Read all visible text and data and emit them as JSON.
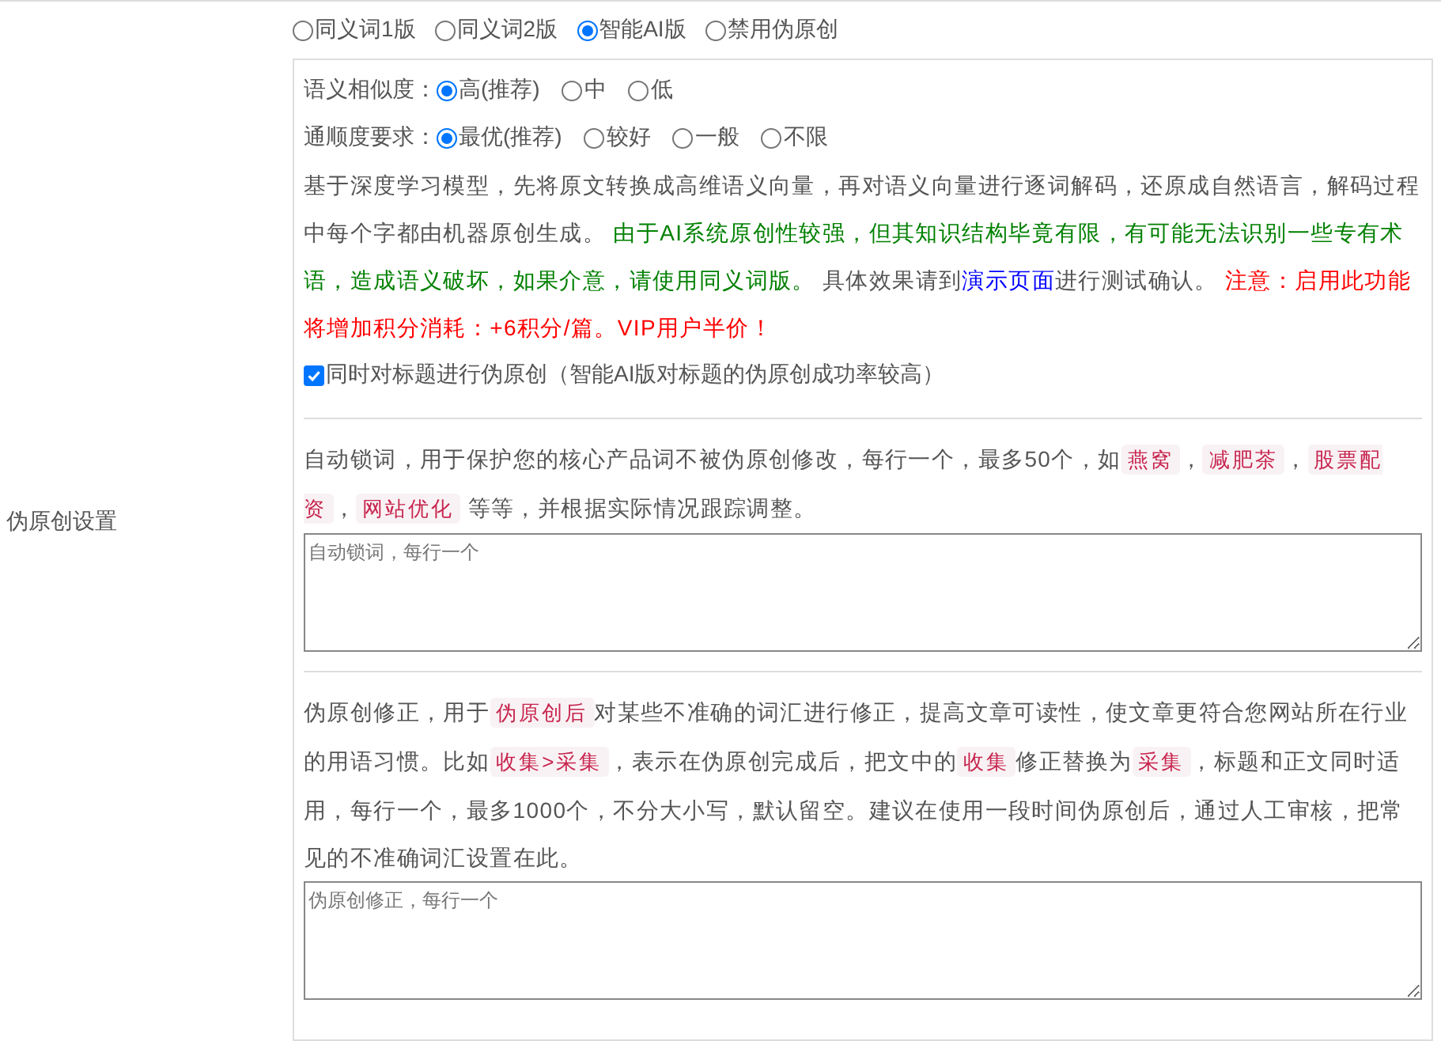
{
  "side_label": "伪原创设置",
  "modes": [
    {
      "label": "同义词1版",
      "selected": false
    },
    {
      "label": "同义词2版",
      "selected": false
    },
    {
      "label": "智能AI版",
      "selected": true
    },
    {
      "label": "禁用伪原创",
      "selected": false
    }
  ],
  "settings": [
    {
      "label": "语义相似度：",
      "options": [
        {
          "label": "高(推荐)",
          "selected": true
        },
        {
          "label": "中",
          "selected": false
        },
        {
          "label": "低",
          "selected": false
        }
      ]
    },
    {
      "label": "通顺度要求：",
      "options": [
        {
          "label": "最优(推荐)",
          "selected": true
        },
        {
          "label": "较好",
          "selected": false
        },
        {
          "label": "一般",
          "selected": false
        },
        {
          "label": "不限",
          "selected": false
        }
      ]
    }
  ],
  "description": [
    {
      "kind": "plain",
      "text": "基于深度学习模型，先将原文转换成高维语义向量，再对语义向量进行逐词解码，还原成自然语言，解码过程中每个字都由机器原创生成。 "
    },
    {
      "kind": "green",
      "text": "由于AI系统原创性较强，但其知识结构毕竟有限，有可能无法识别一些专有术语，造成语义破坏，如果介意，请使用同义词版。"
    },
    {
      "kind": "plain",
      "text": " 具体效果请到"
    },
    {
      "kind": "link",
      "text": "演示页面"
    },
    {
      "kind": "plain",
      "text": "进行测试确认。 "
    },
    {
      "kind": "red",
      "text": "注意：启用此功能将增加积分消耗：+6积分/篇。VIP用户半价！"
    }
  ],
  "title_option": {
    "label": "同时对标题进行伪原创（智能AI版对标题的伪原创成功率较高）",
    "checked": true
  },
  "sections": [
    {
      "description": [
        {
          "kind": "plain",
          "text": "自动锁词，用于保护您的核心产品词不被伪原创修改，每行一个，最多50个，如"
        },
        {
          "kind": "code",
          "text": "燕窝"
        },
        {
          "kind": "plain",
          "text": "，"
        },
        {
          "kind": "code",
          "text": "减肥茶"
        },
        {
          "kind": "plain",
          "text": "，"
        },
        {
          "kind": "code",
          "text": "股票配资"
        },
        {
          "kind": "plain",
          "text": "，"
        },
        {
          "kind": "code",
          "text": "网站优化"
        },
        {
          "kind": "plain",
          "text": " 等等，并根据实际情况跟踪调整。"
        }
      ],
      "placeholder": "自动锁词，每行一个"
    },
    {
      "description": [
        {
          "kind": "plain",
          "text": "伪原创修正，用于"
        },
        {
          "kind": "code",
          "text": "伪原创后"
        },
        {
          "kind": "plain",
          "text": "对某些不准确的词汇进行修正，提高文章可读性，使文章更符合您网站所在行业的用语习惯。比如"
        },
        {
          "kind": "code",
          "text": "收集>采集"
        },
        {
          "kind": "plain",
          "text": "，表示在伪原创完成后，把文中的"
        },
        {
          "kind": "code",
          "text": "收集"
        },
        {
          "kind": "plain",
          "text": "修正替换为"
        },
        {
          "kind": "code",
          "text": "采集"
        },
        {
          "kind": "plain",
          "text": "，标题和正文同时适用，每行一个，最多1000个，不分大小写，默认留空。建议在使用一段时间伪原创后，通过人工审核，把常见的不准确词汇设置在此。"
        }
      ],
      "placeholder": "伪原创修正，每行一个"
    }
  ]
}
